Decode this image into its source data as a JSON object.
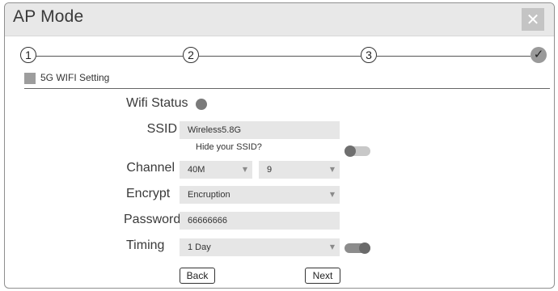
{
  "window": {
    "title": "AP Mode",
    "close_glyph": "✕"
  },
  "stepper": {
    "steps": [
      {
        "label": "1",
        "state": "done"
      },
      {
        "label": "2",
        "state": "done"
      },
      {
        "label": "3",
        "state": "done"
      },
      {
        "label": "✓",
        "state": "complete",
        "icon": "check-icon"
      }
    ]
  },
  "section": {
    "title": "5G WIFI Setting"
  },
  "form": {
    "wifi_status": {
      "label": "Wifi Status",
      "state": "enabled"
    },
    "ssid": {
      "label": "SSID",
      "value": "Wireless5.8G",
      "hide_hint": "Hide your SSID?",
      "hide_enabled": false
    },
    "channel": {
      "label": "Channel",
      "bandwidth": "40M",
      "number": "9"
    },
    "encrypt": {
      "label": "Encrypt",
      "value": "Encruption"
    },
    "password": {
      "label": "Password",
      "value": "66666666"
    },
    "timing": {
      "label": "Timing",
      "value": "1 Day",
      "enabled": true
    }
  },
  "buttons": {
    "back": "Back",
    "next": "Next"
  },
  "icons": {
    "dropdown": "▼"
  },
  "colors": {
    "title_bar": "#e8e8e8",
    "field_bg": "#e6e6e6",
    "close_bg": "#c4c4c4"
  }
}
